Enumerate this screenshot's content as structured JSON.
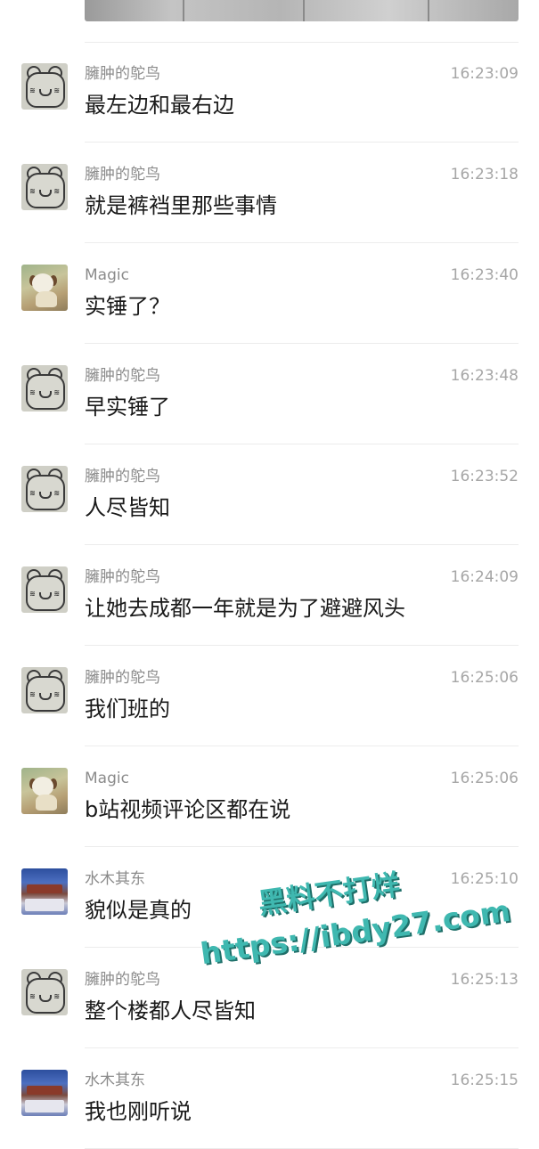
{
  "messages": [
    {
      "sender": "臃肿的鸵鸟",
      "time": "16:23:09",
      "text": "最左边和最右边",
      "avatar": "bear-sticker-avatar"
    },
    {
      "sender": "臃肿的鸵鸟",
      "time": "16:23:18",
      "text": "就是裤裆里那些事情",
      "avatar": "bear-sticker-avatar"
    },
    {
      "sender": "Magic",
      "time": "16:23:40",
      "text": "实锤了？",
      "avatar": "dog-avatar"
    },
    {
      "sender": "臃肿的鸵鸟",
      "time": "16:23:48",
      "text": "早实锤了",
      "avatar": "bear-sticker-avatar"
    },
    {
      "sender": "臃肿的鸵鸟",
      "time": "16:23:52",
      "text": "人尽皆知",
      "avatar": "bear-sticker-avatar"
    },
    {
      "sender": "臃肿的鸵鸟",
      "time": "16:24:09",
      "text": "让她去成都一年就是为了避避风头",
      "avatar": "bear-sticker-avatar"
    },
    {
      "sender": "臃肿的鸵鸟",
      "time": "16:25:06",
      "text": "我们班的",
      "avatar": "bear-sticker-avatar"
    },
    {
      "sender": "Magic",
      "time": "16:25:06",
      "text": "b站视频评论区都在说",
      "avatar": "dog-avatar"
    },
    {
      "sender": "水木其东",
      "time": "16:25:10",
      "text": "貌似是真的",
      "avatar": "scene-avatar"
    },
    {
      "sender": "臃肿的鸵鸟",
      "time": "16:25:13",
      "text": "整个楼都人尽皆知",
      "avatar": "bear-sticker-avatar"
    },
    {
      "sender": "水木其东",
      "time": "16:25:15",
      "text": "我也刚听说",
      "avatar": "scene-avatar"
    }
  ],
  "watermark": {
    "line1": "黑料不打烊",
    "line2": "https://ibdy27.com"
  }
}
